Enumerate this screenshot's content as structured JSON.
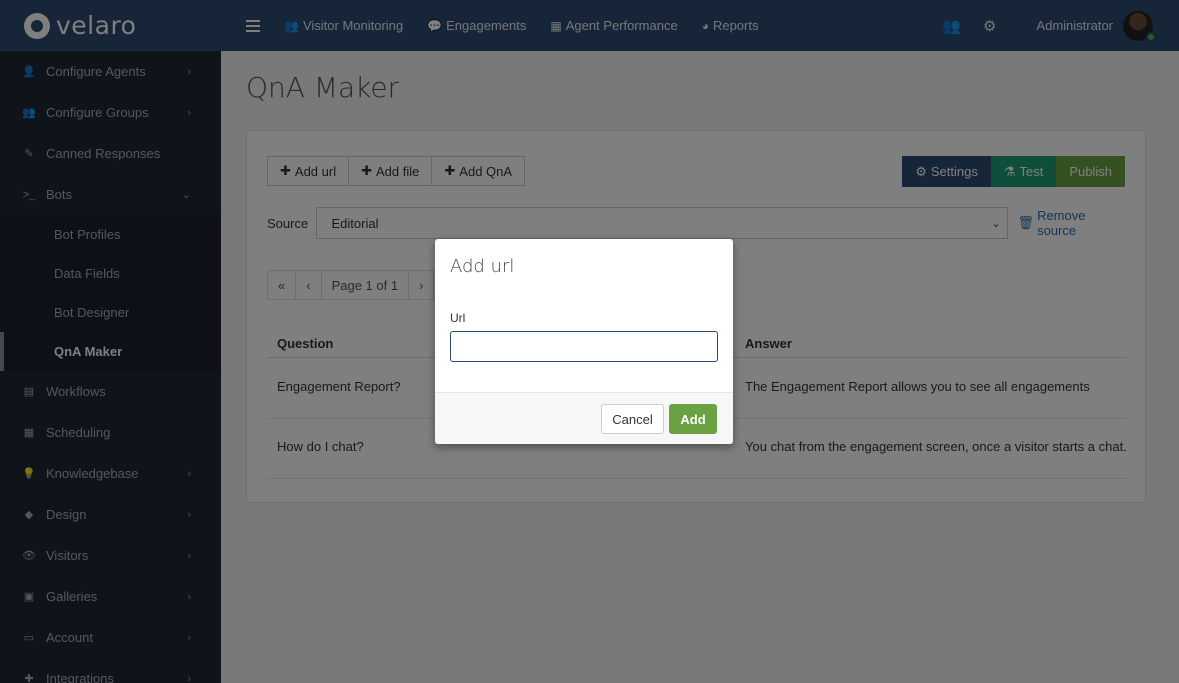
{
  "brand": {
    "name": "velaro"
  },
  "nav": {
    "links": [
      {
        "label": "Visitor Monitoring",
        "icon": "users-icon",
        "glyph": "👥"
      },
      {
        "label": "Engagements",
        "icon": "chat-icon",
        "glyph": "💬"
      },
      {
        "label": "Agent Performance",
        "icon": "grid-icon",
        "glyph": "▦"
      },
      {
        "label": "Reports",
        "icon": "pie-chart-icon",
        "glyph": "◕"
      }
    ],
    "user": "Administrator"
  },
  "sidebar": {
    "items": [
      {
        "label": "Configure Agents",
        "icon": "user-icon",
        "glyph": "👤",
        "chevron": "›"
      },
      {
        "label": "Configure Groups",
        "icon": "users-icon",
        "glyph": "👥",
        "chevron": "›"
      },
      {
        "label": "Canned Responses",
        "icon": "edit-icon",
        "glyph": "✎",
        "chevron": ""
      },
      {
        "label": "Bots",
        "icon": "terminal-icon",
        "glyph": ">_",
        "chevron": "⌄"
      }
    ],
    "bot_sub": [
      "Bot Profiles",
      "Data Fields",
      "Bot Designer",
      "QnA Maker"
    ],
    "items_after": [
      {
        "label": "Workflows",
        "icon": "list-icon",
        "glyph": "▤",
        "chevron": ""
      },
      {
        "label": "Scheduling",
        "icon": "calendar-icon",
        "glyph": "▦",
        "chevron": ""
      },
      {
        "label": "Knowledgebase",
        "icon": "lightbulb-icon",
        "glyph": "💡",
        "chevron": "›"
      },
      {
        "label": "Design",
        "icon": "diamond-icon",
        "glyph": "◆",
        "chevron": "›"
      },
      {
        "label": "Visitors",
        "icon": "eye-icon",
        "glyph": "👁",
        "chevron": "›"
      },
      {
        "label": "Galleries",
        "icon": "image-icon",
        "glyph": "▣",
        "chevron": "›"
      },
      {
        "label": "Account",
        "icon": "card-icon",
        "glyph": "▭",
        "chevron": "›"
      },
      {
        "label": "Integrations",
        "icon": "puzzle-icon",
        "glyph": "✚",
        "chevron": "›"
      }
    ]
  },
  "page": {
    "title": "QnA Maker"
  },
  "toolbar": {
    "add_url": "Add url",
    "add_file": "Add file",
    "add_qna": "Add QnA",
    "settings": "Settings",
    "test": "Test",
    "publish": "Publish"
  },
  "source": {
    "label": "Source",
    "selected": "Editorial",
    "remove": "Remove source"
  },
  "pager": {
    "first": "«",
    "prev": "‹",
    "page": "Page 1 of 1",
    "next": "›"
  },
  "table": {
    "headers": {
      "question": "Question",
      "answer": "Answer"
    },
    "rows": [
      {
        "question": "Engagement Report?",
        "answer": "The Engagement Report allows you to see all engagements"
      },
      {
        "question": "How do I chat?",
        "answer": "You chat from the engagement screen, once a visitor starts a chat."
      }
    ]
  },
  "modal": {
    "title": "Add url",
    "field_label": "Url",
    "field_value": "",
    "cancel": "Cancel",
    "add": "Add"
  },
  "colors": {
    "navbar": "#2c4a6e",
    "sidebar": "#1e2936",
    "settings_btn": "#2c4a6e",
    "test_btn": "#1f9d77",
    "publish_btn": "#6aa243",
    "add_btn": "#6aa243"
  }
}
